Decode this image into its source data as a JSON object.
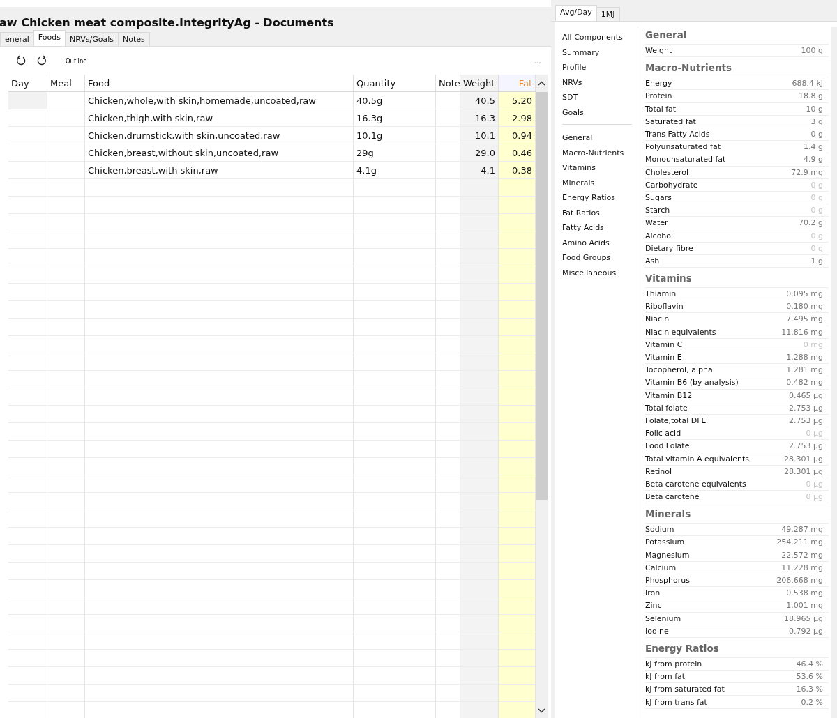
{
  "document": {
    "title": "aw Chicken meat composite.IntegrityAg - Documents",
    "tabs": [
      {
        "label": "eneral",
        "selected": false
      },
      {
        "label": "Foods",
        "selected": true
      },
      {
        "label": "NRVs/Goals",
        "selected": false
      },
      {
        "label": "Notes",
        "selected": false
      }
    ],
    "toolbar": {
      "outline": "Outline",
      "more": "..."
    },
    "table": {
      "columns": [
        "Day",
        "Meal",
        "Food",
        "Quantity",
        "Note",
        "Weight",
        "Fat"
      ],
      "rows": [
        {
          "food": "Chicken,whole,with skin,homemade,uncoated,raw",
          "quantity": "40.5g",
          "weight": "40.5",
          "fat": "5.20"
        },
        {
          "food": "Chicken,thigh,with skin,raw",
          "quantity": "16.3g",
          "weight": "16.3",
          "fat": "2.98"
        },
        {
          "food": "Chicken,drumstick,with skin,uncoated,raw",
          "quantity": "10.1g",
          "weight": "10.1",
          "fat": "0.94"
        },
        {
          "food": "Chicken,breast,without skin,uncoated,raw",
          "quantity": "29g",
          "weight": "29.0",
          "fat": "0.46"
        },
        {
          "food": "Chicken,breast,with skin,raw",
          "quantity": "4.1g",
          "weight": "4.1",
          "fat": "0.38"
        }
      ]
    }
  },
  "analysis": {
    "tabs": [
      {
        "label": "Avg/Day",
        "selected": true
      },
      {
        "label": "1MJ",
        "selected": false
      }
    ],
    "nav_groups": [
      [
        "All Components",
        "Summary",
        "Profile",
        "NRVs",
        "SDT",
        "Goals"
      ],
      [
        "General",
        "Macro-Nutrients",
        "Vitamins",
        "Minerals",
        "Energy Ratios",
        "Fat Ratios",
        "Fatty Acids",
        "Amino Acids",
        "Food Groups",
        "Miscellaneous"
      ]
    ],
    "sections": [
      {
        "heading": "General",
        "rows": [
          {
            "name": "Weight",
            "value": "100 g",
            "dim": false
          }
        ]
      },
      {
        "heading": "Macro-Nutrients",
        "rows": [
          {
            "name": "Energy",
            "value": "688.4 kJ",
            "dim": false
          },
          {
            "name": "Protein",
            "value": "18.8 g",
            "dim": false
          },
          {
            "name": "Total fat",
            "value": "10 g",
            "dim": false
          },
          {
            "name": "Saturated fat",
            "value": "3 g",
            "dim": false
          },
          {
            "name": "Trans Fatty Acids",
            "value": "0 g",
            "dim": false
          },
          {
            "name": "Polyunsaturated fat",
            "value": "1.4 g",
            "dim": false
          },
          {
            "name": "Monounsaturated fat",
            "value": "4.9 g",
            "dim": false
          },
          {
            "name": "Cholesterol",
            "value": "72.9 mg",
            "dim": false
          },
          {
            "name": "Carbohydrate",
            "value": "0 g",
            "dim": true
          },
          {
            "name": "Sugars",
            "value": "0 g",
            "dim": true
          },
          {
            "name": "Starch",
            "value": "0 g",
            "dim": true
          },
          {
            "name": "Water",
            "value": "70.2 g",
            "dim": false
          },
          {
            "name": "Alcohol",
            "value": "0 g",
            "dim": true
          },
          {
            "name": "Dietary fibre",
            "value": "0 g",
            "dim": true
          },
          {
            "name": "Ash",
            "value": "1 g",
            "dim": false
          }
        ]
      },
      {
        "heading": "Vitamins",
        "rows": [
          {
            "name": "Thiamin",
            "value": "0.095 mg",
            "dim": false
          },
          {
            "name": "Riboflavin",
            "value": "0.180 mg",
            "dim": false
          },
          {
            "name": "Niacin",
            "value": "7.495 mg",
            "dim": false
          },
          {
            "name": "Niacin equivalents",
            "value": "11.816 mg",
            "dim": false
          },
          {
            "name": "Vitamin C",
            "value": "0 mg",
            "dim": true
          },
          {
            "name": "Vitamin E",
            "value": "1.288 mg",
            "dim": false
          },
          {
            "name": "Tocopherol, alpha",
            "value": "1.281 mg",
            "dim": false
          },
          {
            "name": "Vitamin B6 (by analysis)",
            "value": "0.482 mg",
            "dim": false
          },
          {
            "name": "Vitamin B12",
            "value": "0.465 µg",
            "dim": false
          },
          {
            "name": "Total folate",
            "value": "2.753 µg",
            "dim": false
          },
          {
            "name": "Folate,total DFE",
            "value": "2.753 µg",
            "dim": false
          },
          {
            "name": "Folic acid",
            "value": "0 µg",
            "dim": true
          },
          {
            "name": "Food Folate",
            "value": "2.753 µg",
            "dim": false
          },
          {
            "name": "Total vitamin A equivalents",
            "value": "28.301 µg",
            "dim": false
          },
          {
            "name": "Retinol",
            "value": "28.301 µg",
            "dim": false
          },
          {
            "name": "Beta carotene equivalents",
            "value": "0 µg",
            "dim": true
          },
          {
            "name": "Beta carotene",
            "value": "0 µg",
            "dim": true
          }
        ]
      },
      {
        "heading": "Minerals",
        "rows": [
          {
            "name": "Sodium",
            "value": "49.287 mg",
            "dim": false
          },
          {
            "name": "Potassium",
            "value": "254.211 mg",
            "dim": false
          },
          {
            "name": "Magnesium",
            "value": "22.572 mg",
            "dim": false
          },
          {
            "name": "Calcium",
            "value": "11.228 mg",
            "dim": false
          },
          {
            "name": "Phosphorus",
            "value": "206.668 mg",
            "dim": false
          },
          {
            "name": "Iron",
            "value": "0.538 mg",
            "dim": false
          },
          {
            "name": "Zinc",
            "value": "1.001 mg",
            "dim": false
          },
          {
            "name": "Selenium",
            "value": "18.965 µg",
            "dim": false
          },
          {
            "name": "Iodine",
            "value": "0.792 µg",
            "dim": false
          }
        ]
      },
      {
        "heading": "Energy Ratios",
        "rows": [
          {
            "name": "kJ from protein",
            "value": "46.4 %",
            "dim": false
          },
          {
            "name": "kJ from fat",
            "value": "53.6 %",
            "dim": false
          },
          {
            "name": "kJ from saturated fat",
            "value": "16.3 %",
            "dim": false
          },
          {
            "name": "kJ from trans fat",
            "value": "0.2 %",
            "dim": false
          }
        ]
      }
    ]
  }
}
